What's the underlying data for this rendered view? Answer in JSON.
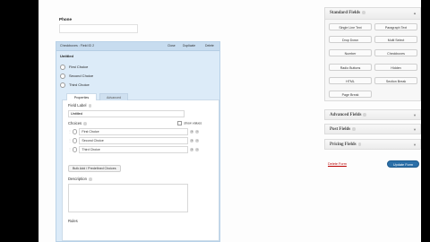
{
  "phone": {
    "label": "Phone"
  },
  "editor": {
    "title": "Checkboxes : Field ID 2",
    "links": {
      "close": "Close",
      "duplicate": "Duplicate",
      "delete": "Delete"
    },
    "preview_title": "Untitled",
    "preview_choices": [
      "First Choice",
      "Second Choice",
      "Third Choice"
    ],
    "tabs": {
      "properties": "Properties",
      "advanced": "Advanced"
    },
    "field_label": {
      "label": "Field Label",
      "value": "Untitled"
    },
    "choices": {
      "label": "Choices",
      "show_values": "show values",
      "items": [
        "First Choice",
        "Second Choice",
        "Third Choice"
      ]
    },
    "bulk_add_label": "Bulk Add / Predefined Choices",
    "description_label": "Description",
    "rules_label": "Rules"
  },
  "sidebar": {
    "standard_fields": {
      "title": "Standard Fields",
      "buttons": [
        "Single Line Text",
        "Paragraph Text",
        "Drop Down",
        "Multi Select",
        "Number",
        "Checkboxes",
        "Radio Buttons",
        "Hidden",
        "HTML",
        "Section Break",
        "Page Break"
      ]
    },
    "advanced_fields": {
      "title": "Advanced Fields"
    },
    "post_fields": {
      "title": "Post Fields"
    },
    "pricing_fields": {
      "title": "Pricing Fields"
    },
    "delete_form": "Delete Form",
    "update_form": "Update Form"
  }
}
